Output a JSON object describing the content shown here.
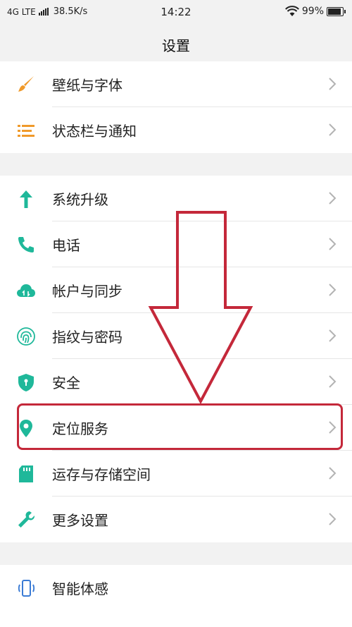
{
  "status_bar": {
    "network": "4G LTE",
    "speed": "38.5K/s",
    "time": "14:22",
    "battery": "99%"
  },
  "header": {
    "title": "设置"
  },
  "groups": [
    {
      "items": [
        {
          "label": "壁纸与字体",
          "icon": "brush-icon"
        },
        {
          "label": "状态栏与通知",
          "icon": "status-bar-icon"
        }
      ]
    },
    {
      "items": [
        {
          "label": "系统升级",
          "icon": "arrow-up-icon"
        },
        {
          "label": "电话",
          "icon": "phone-icon"
        },
        {
          "label": "帐户与同步",
          "icon": "cloud-sync-icon"
        },
        {
          "label": "指纹与密码",
          "icon": "fingerprint-icon"
        },
        {
          "label": "安全",
          "icon": "shield-icon"
        },
        {
          "label": "定位服务",
          "icon": "location-pin-icon",
          "highlighted": true
        },
        {
          "label": "运存与存储空间",
          "icon": "sd-card-icon"
        },
        {
          "label": "更多设置",
          "icon": "wrench-icon"
        }
      ]
    },
    {
      "items": [
        {
          "label": "智能体感",
          "icon": "phone-motion-icon"
        }
      ]
    }
  ],
  "colors": {
    "accent": "#1fb89a",
    "orange": "#f09a2b",
    "blue": "#3a7bd5",
    "highlight": "#c4283a",
    "background": "#f2f2f2"
  }
}
